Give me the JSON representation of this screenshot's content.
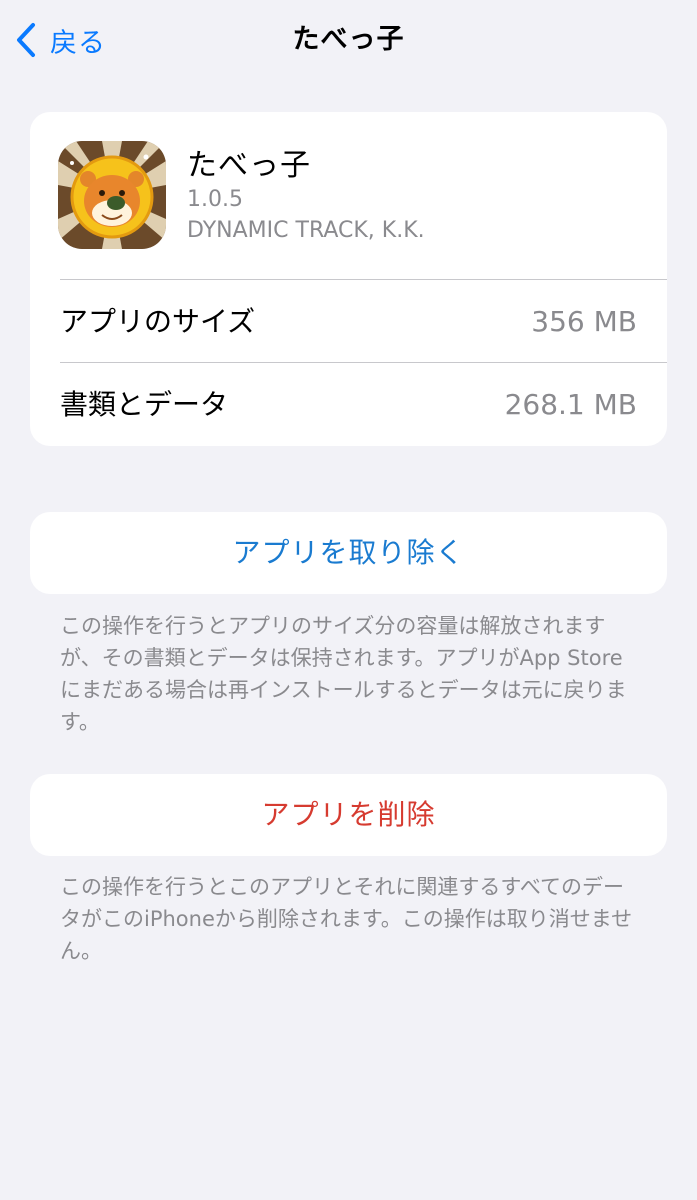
{
  "nav": {
    "back_label": "戻る",
    "title": "たべっ子"
  },
  "app": {
    "name": "たべっ子",
    "version": "1.0.5",
    "developer": "DYNAMIC TRACK, K.K.",
    "icon": "lion-app-icon"
  },
  "storage": {
    "rows": [
      {
        "label": "アプリのサイズ",
        "value": "356 MB"
      },
      {
        "label": "書類とデータ",
        "value": "268.1 MB"
      }
    ]
  },
  "offload": {
    "label": "アプリを取り除く",
    "footnote": "この操作を行うとアプリのサイズ分の容量は解放されますが、その書類とデータは保持されます。アプリがApp Storeにまだある場合は再インストールするとデータは元に戻ります。"
  },
  "delete": {
    "label": "アプリを削除",
    "footnote": "この操作を行うとこのアプリとそれに関連するすべてのデータがこのiPhoneから削除されます。この操作は取り消せません。"
  },
  "colors": {
    "accent": "#0a7aff",
    "offload": "#1a7bd0",
    "destructive": "#d63b30",
    "background": "#f2f2f7",
    "secondary_text": "#8a8a8e"
  }
}
